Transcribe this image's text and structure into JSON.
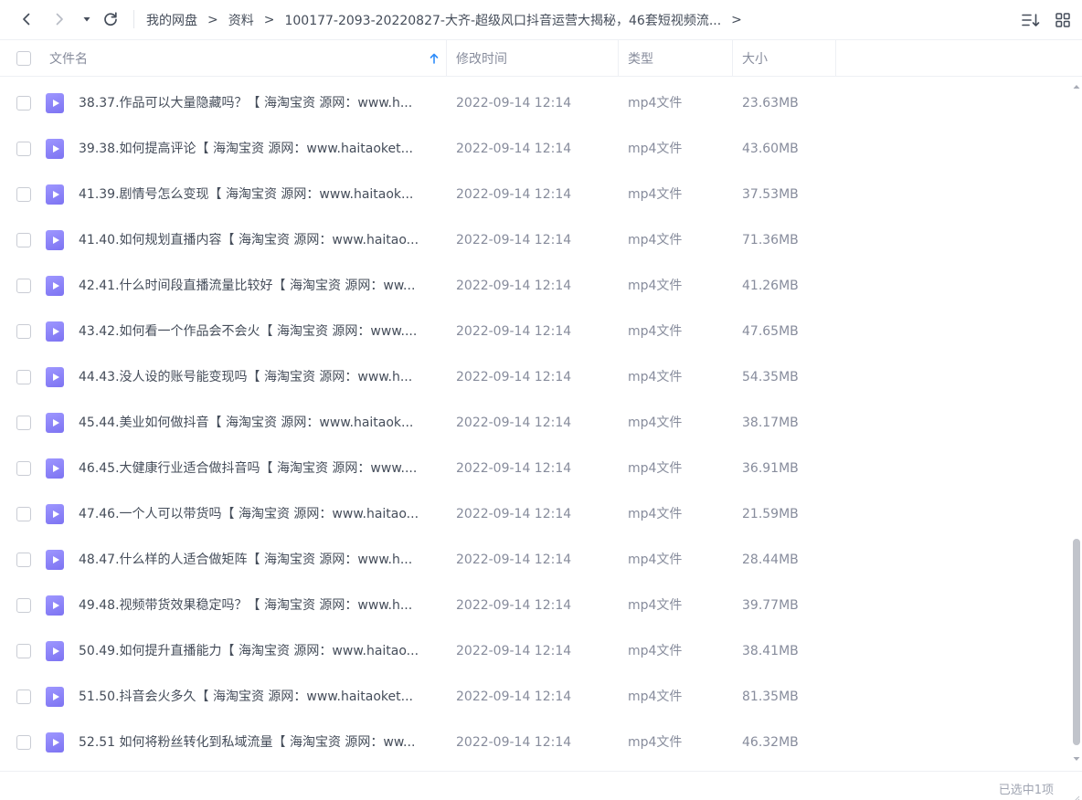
{
  "toolbar": {
    "back_icon": "chevron-left-icon",
    "forward_icon": "chevron-right-icon",
    "history_icon": "caret-down-icon",
    "refresh_icon": "refresh-icon",
    "breadcrumb": [
      "我的网盘",
      "资料",
      "100177-2093-20220827-大齐-超级风口抖音运营大揭秘，46套短视频流..."
    ],
    "separator": ">",
    "sort_icon": "sort-list-icon",
    "view_icon": "grid-view-icon"
  },
  "columns": {
    "name": "文件名",
    "modified": "修改时间",
    "type": "类型",
    "size": "大小",
    "sort_indicator": "↑"
  },
  "files": [
    {
      "name": "38.37.作品可以大量隐藏吗？【 海淘宝资 源网：www.h...",
      "modified": "2022-09-14 12:14",
      "type": "mp4文件",
      "size": "23.63MB"
    },
    {
      "name": "39.38.如何提高评论【 海淘宝资 源网：www.haitaoket...",
      "modified": "2022-09-14 12:14",
      "type": "mp4文件",
      "size": "43.60MB"
    },
    {
      "name": "41.39.剧情号怎么变现【 海淘宝资 源网：www.haitaok...",
      "modified": "2022-09-14 12:14",
      "type": "mp4文件",
      "size": "37.53MB"
    },
    {
      "name": "41.40.如何规划直播内容【 海淘宝资 源网：www.haitao...",
      "modified": "2022-09-14 12:14",
      "type": "mp4文件",
      "size": "71.36MB"
    },
    {
      "name": "42.41.什么时间段直播流量比较好【 海淘宝资 源网：ww...",
      "modified": "2022-09-14 12:14",
      "type": "mp4文件",
      "size": "41.26MB"
    },
    {
      "name": "43.42.如何看一个作品会不会火【 海淘宝资 源网：www....",
      "modified": "2022-09-14 12:14",
      "type": "mp4文件",
      "size": "47.65MB"
    },
    {
      "name": "44.43.没人设的账号能变现吗【 海淘宝资 源网：www.h...",
      "modified": "2022-09-14 12:14",
      "type": "mp4文件",
      "size": "54.35MB"
    },
    {
      "name": "45.44.美业如何做抖音【 海淘宝资 源网：www.haitaok...",
      "modified": "2022-09-14 12:14",
      "type": "mp4文件",
      "size": "38.17MB"
    },
    {
      "name": "46.45.大健康行业适合做抖音吗【 海淘宝资 源网：www....",
      "modified": "2022-09-14 12:14",
      "type": "mp4文件",
      "size": "36.91MB"
    },
    {
      "name": "47.46.一个人可以带货吗【 海淘宝资 源网：www.haitao...",
      "modified": "2022-09-14 12:14",
      "type": "mp4文件",
      "size": "21.59MB"
    },
    {
      "name": "48.47.什么样的人适合做矩阵【 海淘宝资 源网：www.h...",
      "modified": "2022-09-14 12:14",
      "type": "mp4文件",
      "size": "28.44MB"
    },
    {
      "name": "49.48.视频带货效果稳定吗？【 海淘宝资 源网：www.h...",
      "modified": "2022-09-14 12:14",
      "type": "mp4文件",
      "size": "39.77MB"
    },
    {
      "name": "50.49.如何提升直播能力【 海淘宝资 源网：www.haitao...",
      "modified": "2022-09-14 12:14",
      "type": "mp4文件",
      "size": "38.41MB"
    },
    {
      "name": "51.50.抖音会火多久【 海淘宝资 源网：www.haitaoket...",
      "modified": "2022-09-14 12:14",
      "type": "mp4文件",
      "size": "81.35MB"
    },
    {
      "name": "52.51 如何将粉丝转化到私域流量【 海淘宝资 源网：ww...",
      "modified": "2022-09-14 12:14",
      "type": "mp4文件",
      "size": "46.32MB"
    }
  ],
  "file_icon": "video-file-icon",
  "status": {
    "selected_text": "已选中1项"
  },
  "colors": {
    "file_icon": "#8b83f7",
    "sort_arrow": "#2f8dfa",
    "text_primary": "#454d5a",
    "text_secondary": "#878c9c"
  }
}
